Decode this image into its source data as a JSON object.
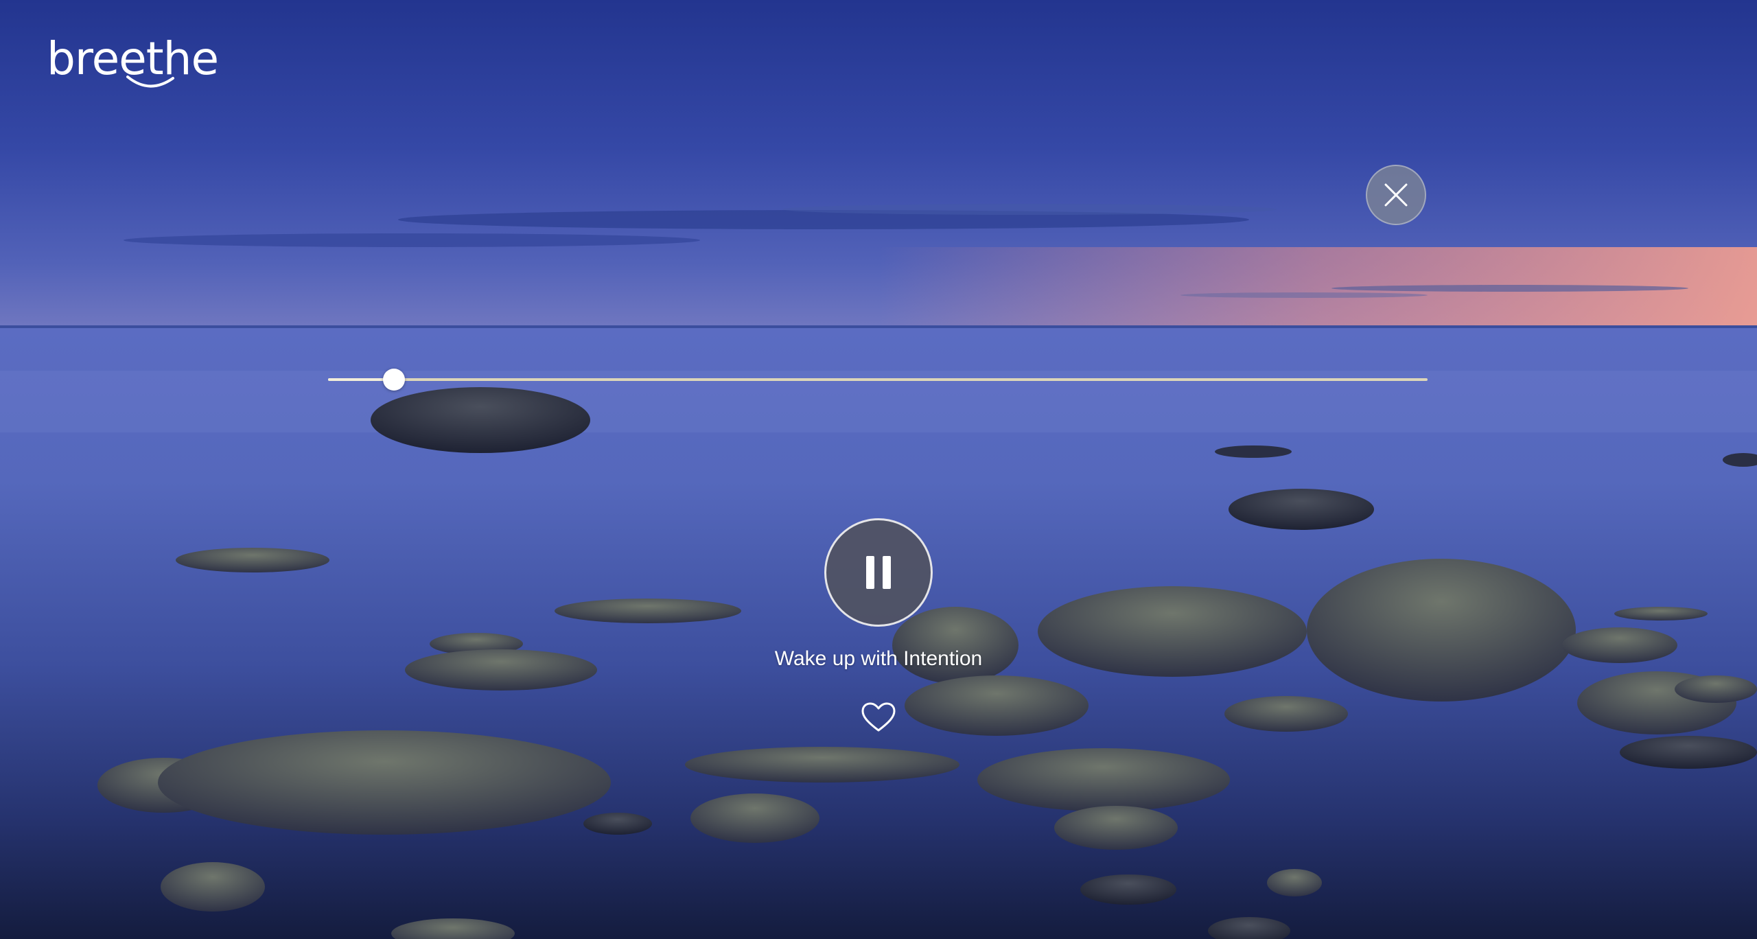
{
  "app": {
    "logo_text": "breethe"
  },
  "player": {
    "track_title": "Wake up with Intention",
    "progress_fraction": 0.06,
    "state": "playing",
    "pause_icon": "pause-icon",
    "close_icon": "close-icon",
    "favorite_icon": "heart-outline-icon"
  },
  "colors": {
    "sky_top": "#23358f",
    "sky_horizon": "#f08e8a",
    "sea": "#4a5fb5",
    "progress_track": "#ddd6b8",
    "knob": "#ffffff"
  }
}
